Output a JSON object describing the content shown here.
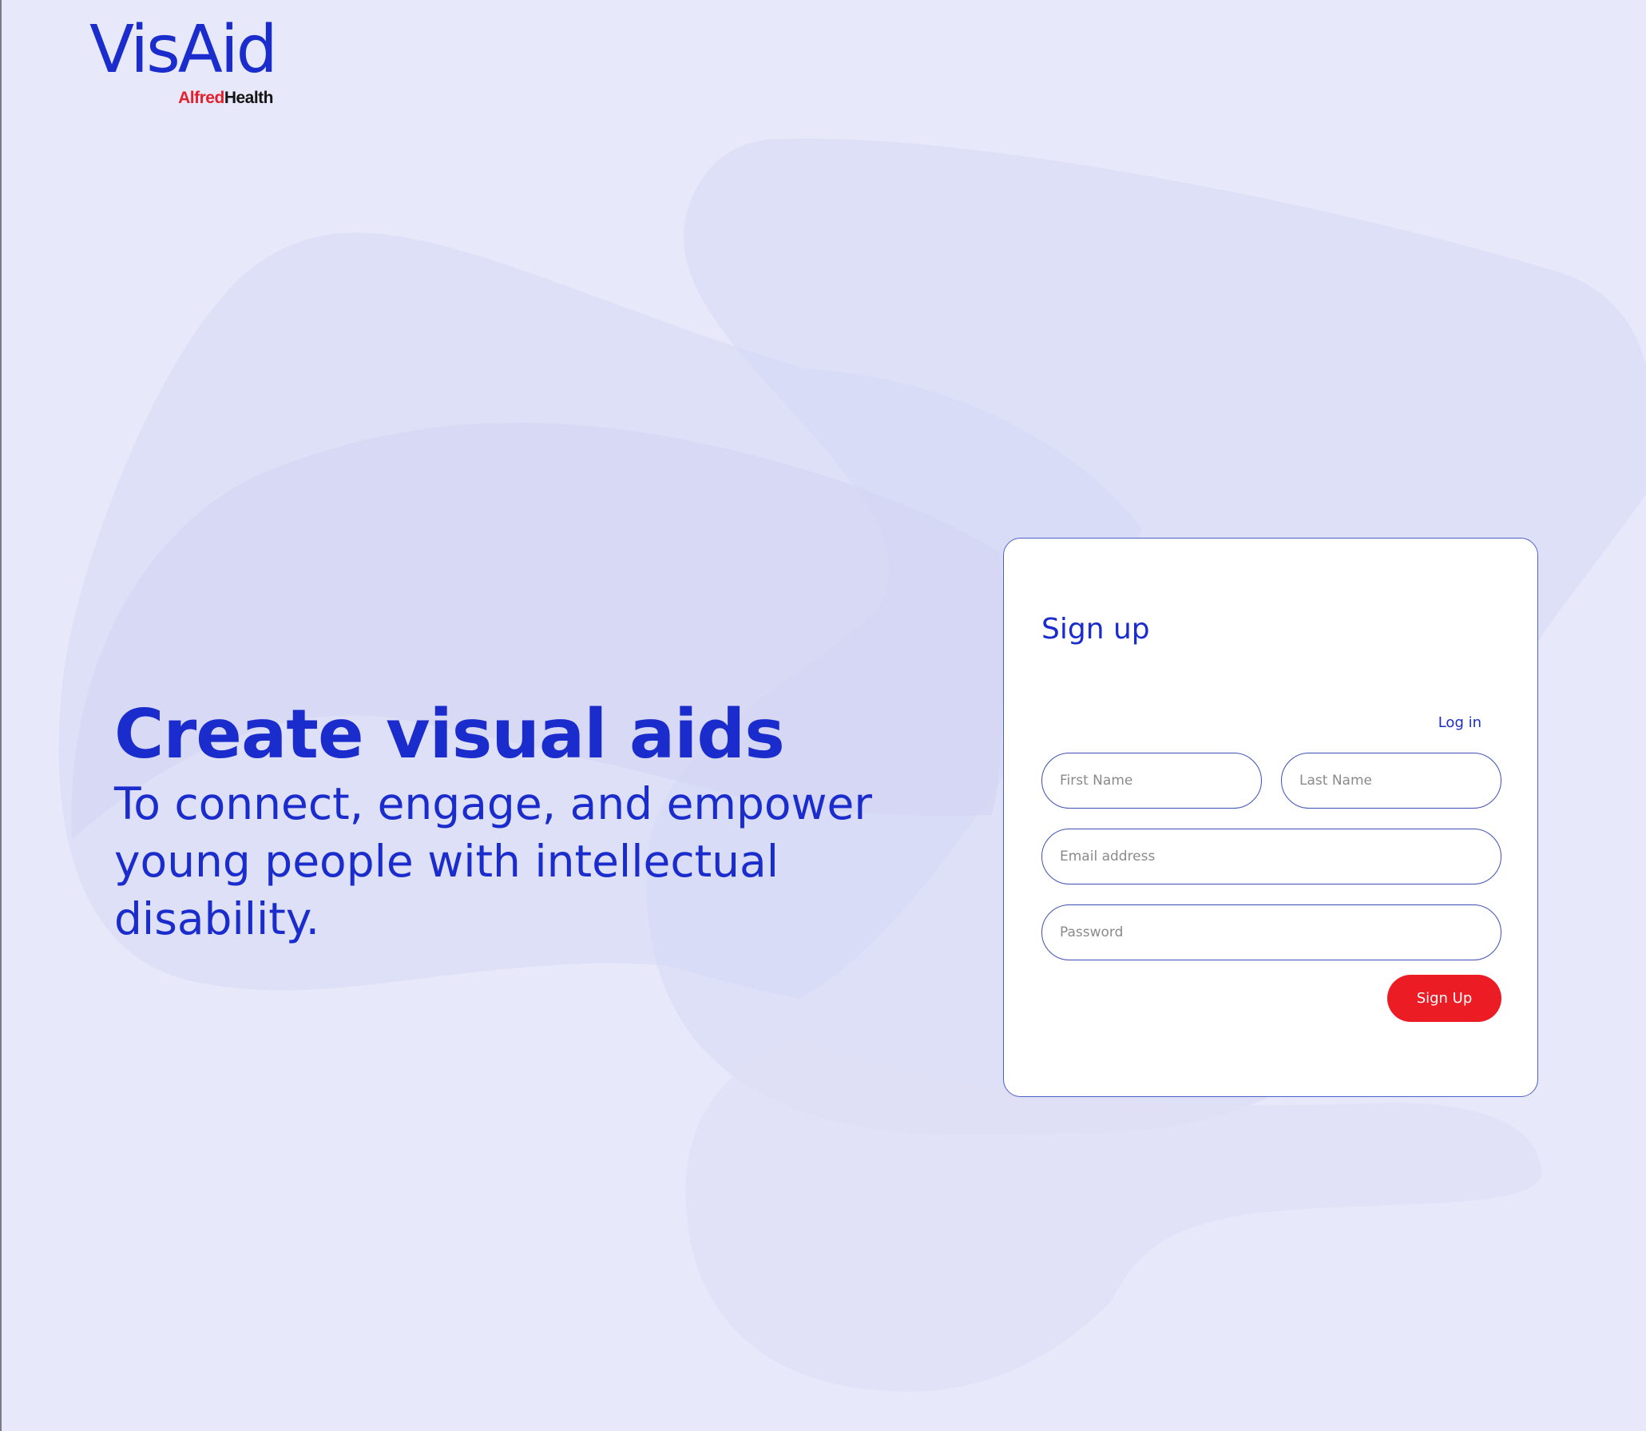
{
  "brand": {
    "logo_text": "VisAid",
    "partner_alfred": "Alfred",
    "partner_health": "Health"
  },
  "hero": {
    "title": "Create visual aids",
    "subtitle": "To connect, engage, and empower young people with intellectual disability."
  },
  "signup_form": {
    "title": "Sign up",
    "login_link": "Log in",
    "first_name_placeholder": "First Name",
    "last_name_placeholder": "Last Name",
    "email_placeholder": "Email address",
    "password_placeholder": "Password",
    "submit_label": "Sign Up"
  },
  "colors": {
    "primary_blue": "#1a2ccc",
    "accent_red": "#ec1c24",
    "background": "#e7e8f9",
    "card_border": "#4f5fc8"
  }
}
